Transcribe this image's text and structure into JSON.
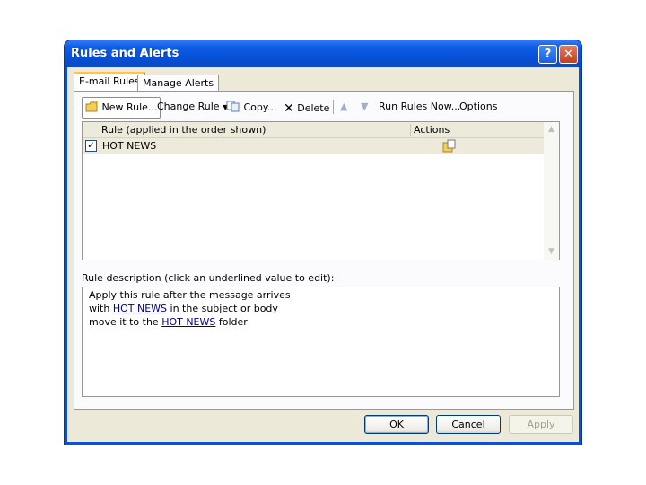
{
  "window": {
    "title": "Rules and Alerts",
    "help_glyph": "?",
    "close_glyph": "✕"
  },
  "tabs": [
    {
      "label": "E-mail Rules",
      "active": true
    },
    {
      "label": "Manage Alerts",
      "active": false
    }
  ],
  "toolbar": {
    "new_rule": "New Rule...",
    "change_rule": "Change Rule",
    "copy": "Copy...",
    "delete": "Delete",
    "run_rules_now": "Run Rules Now...",
    "options": "Options"
  },
  "rules_list": {
    "columns": [
      "Rule (applied in the order shown)",
      "Actions"
    ],
    "rows": [
      {
        "name": "HOT NEWS",
        "checked": true
      }
    ]
  },
  "description": {
    "label": "Rule description (click an underlined value to edit):",
    "line1": "Apply this rule after the message arrives",
    "line2_prefix": "with ",
    "line2_link": "HOT NEWS",
    "line2_suffix": " in the subject or body",
    "line3_prefix": "move it to the ",
    "line3_link": "HOT NEWS",
    "line3_suffix": " folder"
  },
  "buttons": {
    "ok": "OK",
    "cancel": "Cancel",
    "apply": "Apply"
  },
  "colors": {
    "titlebar": "#0a51d6",
    "dialog_bg": "#ece9d8",
    "link": "#00008b",
    "row_highlight": "#eeeadb"
  },
  "icons": [
    "help-icon",
    "close-icon",
    "new-rule-icon",
    "dropdown-arrow-icon",
    "copy-icon",
    "delete-icon",
    "move-up-icon",
    "move-down-icon",
    "checkbox-icon",
    "action-move-icon",
    "scroll-up-icon",
    "scroll-down-icon"
  ]
}
